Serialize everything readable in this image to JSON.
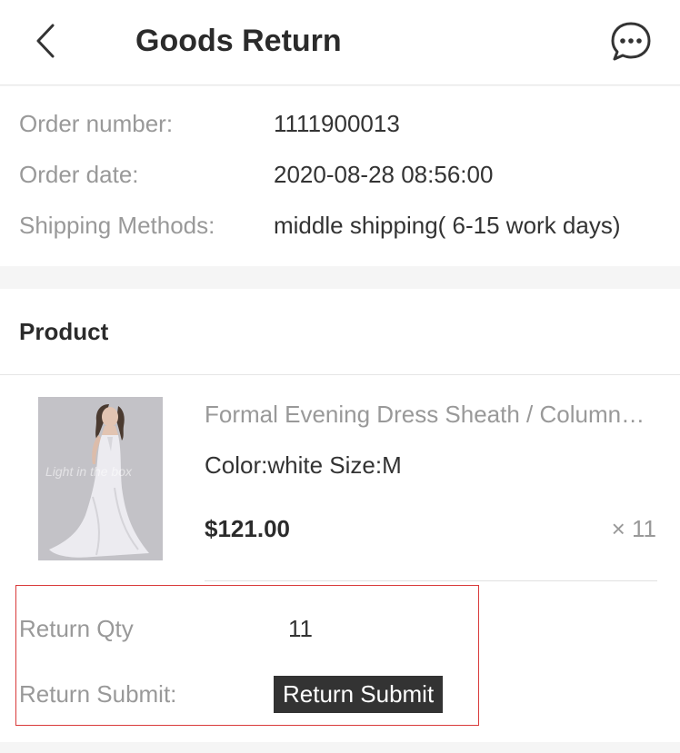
{
  "header": {
    "title": "Goods Return",
    "back_icon": "chevron-left-icon",
    "chat_icon": "chat-bubble-icon"
  },
  "order": {
    "number_label": "Order number:",
    "number_value": "1111900013",
    "date_label": "Order date:",
    "date_value": "2020-08-28 08:56:00",
    "shipping_label": "Shipping Methods:",
    "shipping_value": "middle shipping( 6-15 work days)"
  },
  "product_section": {
    "title": "Product",
    "item": {
      "name": "Formal Evening Dress Sheath / Column V-neck Court Train Chiffon with Draping",
      "attributes": "Color:white Size:M",
      "price": "$121.00",
      "quantity": "× 11"
    }
  },
  "return_form": {
    "qty_label": "Return Qty",
    "qty_value": "11",
    "submit_label": "Return Submit:",
    "submit_button": "Return Submit"
  },
  "colors": {
    "highlight_border": "#d93b3b",
    "button_bg": "#333333",
    "muted_text": "#999999"
  }
}
